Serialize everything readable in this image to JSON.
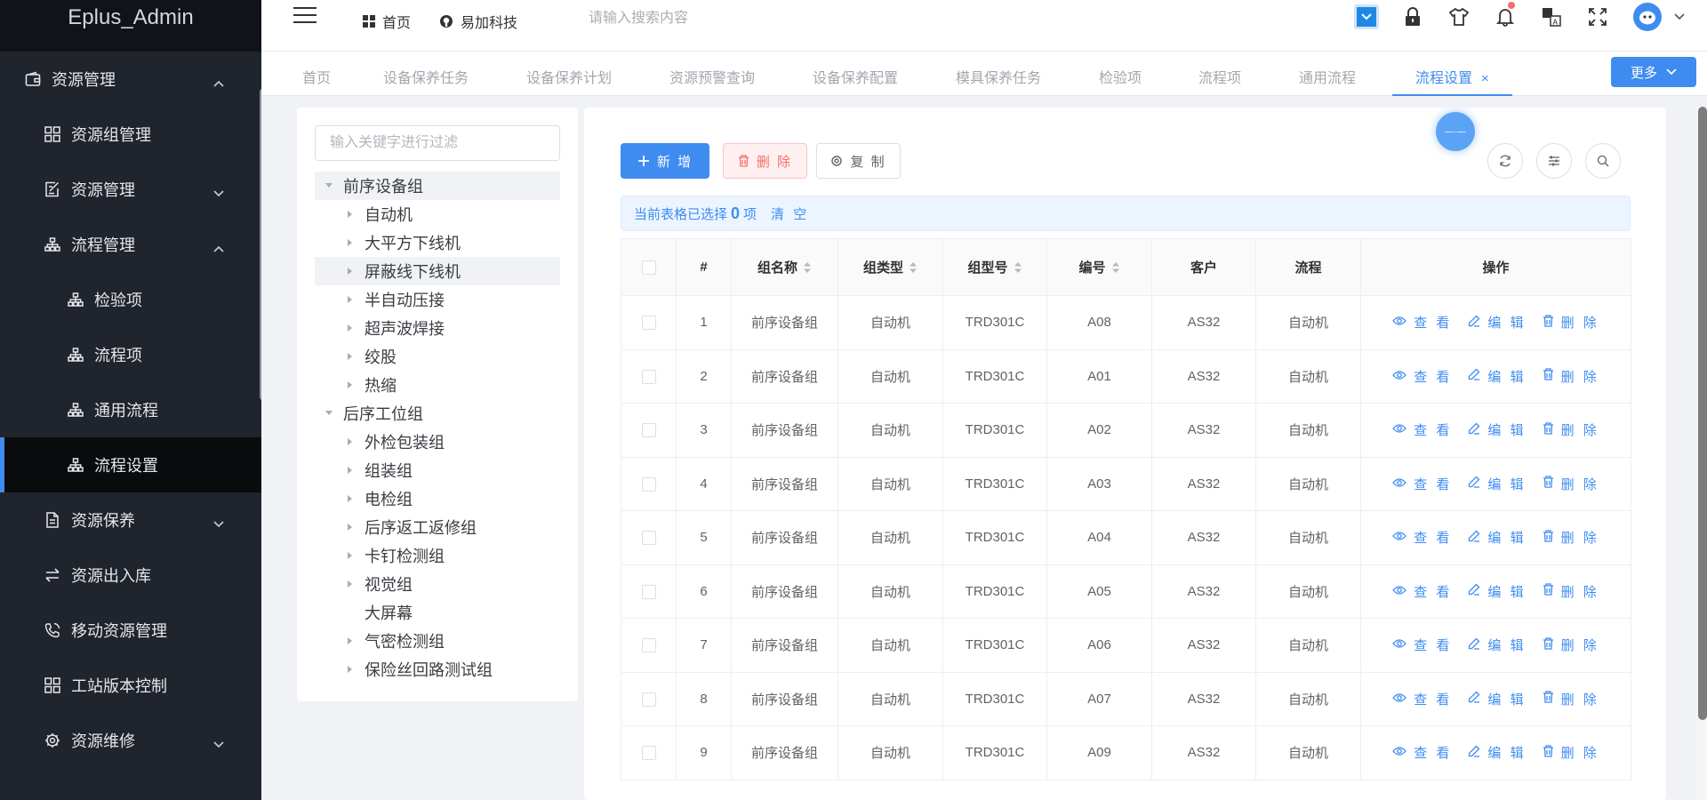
{
  "app": {
    "title": "Eplus_Admin"
  },
  "sidebar": {
    "items": [
      {
        "label": "资源管理",
        "icon": "wallet-icon",
        "level": 0,
        "arrow": "up"
      },
      {
        "label": "资源组管理",
        "icon": "grid-icon",
        "level": 1
      },
      {
        "label": "资源管理",
        "icon": "edit-doc-icon",
        "level": 1,
        "arrow": "down"
      },
      {
        "label": "流程管理",
        "icon": "org-chart-icon",
        "level": 1,
        "arrow": "up"
      },
      {
        "label": "检验项",
        "icon": "org-chart-icon",
        "level": 2
      },
      {
        "label": "流程项",
        "icon": "org-chart-icon",
        "level": 2
      },
      {
        "label": "通用流程",
        "icon": "org-chart-icon",
        "level": 2
      },
      {
        "label": "流程设置",
        "icon": "org-chart-icon",
        "level": 2,
        "active": true
      },
      {
        "label": "资源保养",
        "icon": "document-icon",
        "level": 1,
        "arrow": "down"
      },
      {
        "label": "资源出入库",
        "icon": "exchange-icon",
        "level": 1
      },
      {
        "label": "移动资源管理",
        "icon": "phone-call-icon",
        "level": 1
      },
      {
        "label": "工站版本控制",
        "icon": "grid-icon",
        "level": 1
      },
      {
        "label": "资源维修",
        "icon": "gear-icon",
        "level": 1,
        "arrow": "down"
      }
    ]
  },
  "header": {
    "home_label": "首页",
    "company_label": "易加科技",
    "search_placeholder": "请输入搜索内容"
  },
  "tabs": {
    "items": [
      "首页",
      "设备保养任务",
      "设备保养计划",
      "资源预警查询",
      "设备保养配置",
      "模具保养任务",
      "检验项",
      "流程项",
      "通用流程"
    ],
    "active": "流程设置",
    "close_glyph": "×",
    "more_label": "更多"
  },
  "tree": {
    "filter_placeholder": "输入关键字进行过滤",
    "groups": [
      {
        "label": "前序设备组",
        "children": [
          "自动机",
          "大平方下线机",
          "屏蔽线下线机",
          "半自动压接",
          "超声波焊接",
          "绞股",
          "热缩"
        ]
      },
      {
        "label": "后序工位组",
        "children": [
          "外检包装组",
          "组装组",
          "电检组",
          "后序返工返修组",
          "卡钉检测组",
          "视觉组",
          "大屏幕",
          "气密检测组",
          "保险丝回路测试组"
        ]
      }
    ]
  },
  "toolbar": {
    "add_label": "新 增",
    "delete_label": "删 除",
    "copy_label": "复 制",
    "float_ball_text": "—·—"
  },
  "selection": {
    "prefix": "当前表格已选择",
    "count": "0",
    "suffix": "项",
    "clear_label": "清 空"
  },
  "table": {
    "headers": [
      "#",
      "组名称",
      "组类型",
      "组型号",
      "编号",
      "客户",
      "流程",
      "操作"
    ],
    "rows": [
      [
        "1",
        "前序设备组",
        "自动机",
        "TRD301C",
        "A08",
        "AS32",
        "自动机"
      ],
      [
        "2",
        "前序设备组",
        "自动机",
        "TRD301C",
        "A01",
        "AS32",
        "自动机"
      ],
      [
        "3",
        "前序设备组",
        "自动机",
        "TRD301C",
        "A02",
        "AS32",
        "自动机"
      ],
      [
        "4",
        "前序设备组",
        "自动机",
        "TRD301C",
        "A03",
        "AS32",
        "自动机"
      ],
      [
        "5",
        "前序设备组",
        "自动机",
        "TRD301C",
        "A04",
        "AS32",
        "自动机"
      ],
      [
        "6",
        "前序设备组",
        "自动机",
        "TRD301C",
        "A05",
        "AS32",
        "自动机"
      ],
      [
        "7",
        "前序设备组",
        "自动机",
        "TRD301C",
        "A06",
        "AS32",
        "自动机"
      ],
      [
        "8",
        "前序设备组",
        "自动机",
        "TRD301C",
        "A07",
        "AS32",
        "自动机"
      ],
      [
        "9",
        "前序设备组",
        "自动机",
        "TRD301C",
        "A09",
        "AS32",
        "自动机"
      ]
    ],
    "actions": {
      "view": "查 看",
      "edit": "编 辑",
      "delete": "删 除"
    }
  },
  "colors": {
    "primary": "#3f8cf0",
    "danger": "#f56c6c",
    "sidebar_bg": "#20242c"
  }
}
